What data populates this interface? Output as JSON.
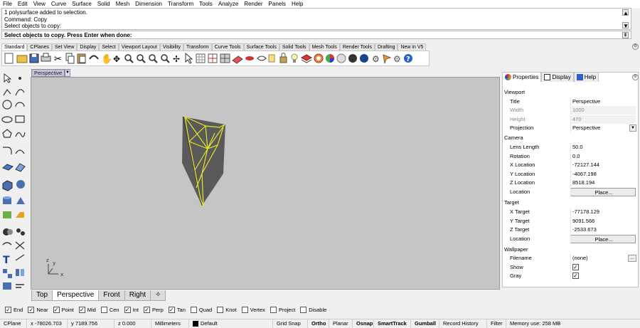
{
  "menu": [
    "File",
    "Edit",
    "View",
    "Curve",
    "Surface",
    "Solid",
    "Mesh",
    "Dimension",
    "Transform",
    "Tools",
    "Analyze",
    "Render",
    "Panels",
    "Help"
  ],
  "command_history": [
    "1 polysurface added to selection.",
    "Command: Copy",
    "Select objects to copy:"
  ],
  "command_prompt": "Select objects to copy. Press Enter when done:",
  "toolbar_tabs": [
    "Standard",
    "CPlanes",
    "Set View",
    "Display",
    "Select",
    "Viewport Layout",
    "Visibility",
    "Transform",
    "Curve Tools",
    "Surface Tools",
    "Solid Tools",
    "Mesh Tools",
    "Render Tools",
    "Drafting",
    "New in V5"
  ],
  "viewport": {
    "label": "Perspective"
  },
  "viewport_tabs": [
    "Top",
    "Perspective",
    "Front",
    "Right"
  ],
  "osnap": [
    {
      "label": "End",
      "checked": true
    },
    {
      "label": "Near",
      "checked": true
    },
    {
      "label": "Point",
      "checked": true
    },
    {
      "label": "Mid",
      "checked": true
    },
    {
      "label": "Cen",
      "checked": false
    },
    {
      "label": "Int",
      "checked": true
    },
    {
      "label": "Perp",
      "checked": true
    },
    {
      "label": "Tan",
      "checked": true
    },
    {
      "label": "Quad",
      "checked": false
    },
    {
      "label": "Knot",
      "checked": false
    },
    {
      "label": "Vertex",
      "checked": false
    },
    {
      "label": "Project",
      "checked": false
    },
    {
      "label": "Disable",
      "checked": false
    }
  ],
  "status": {
    "cplane": "CPlane",
    "x": "x -78026.703",
    "y": "y 7189.756",
    "z": "z 0.000",
    "units": "Millimeters",
    "layer": "Default",
    "grid_snap": "Grid Snap",
    "ortho": "Ortho",
    "planar": "Planar",
    "osnap": "Osnap",
    "smarttrack": "SmartTrack",
    "gumball": "Gumball",
    "record_history": "Record History",
    "filter": "Filter",
    "memory": "Memory use: 258 MB"
  },
  "panel": {
    "tabs": [
      "Properties",
      "Display",
      "Help"
    ],
    "viewport_section": "Viewport",
    "title_label": "Title",
    "title_value": "Perspective",
    "width_label": "Width",
    "width_value": "1000",
    "height_label": "Height",
    "height_value": "470",
    "projection_label": "Projection",
    "projection_value": "Perspective",
    "camera_section": "Camera",
    "lens_label": "Lens Length",
    "lens_value": "50.0",
    "rotation_label": "Rotation",
    "rotation_value": "0.0",
    "xloc_label": "X Location",
    "xloc_value": "-72127.144",
    "yloc_label": "Y Location",
    "yloc_value": "-4067.198",
    "zloc_label": "Z Location",
    "zloc_value": "8518.194",
    "location_label": "Location",
    "place_button": "Place...",
    "target_section": "Target",
    "xt_label": "X Target",
    "xt_value": "-77178.129",
    "yt_label": "Y Target",
    "yt_value": "9091.566",
    "zt_label": "Z Target",
    "zt_value": "-2533.673",
    "tloc_label": "Location",
    "tplace_button": "Place...",
    "wallpaper_section": "Wallpaper",
    "filename_label": "Filename",
    "filename_value": "(none)",
    "browse_button": "...",
    "show_label": "Show",
    "show_checked": true,
    "gray_label": "Gray",
    "gray_checked": true
  },
  "axis": {
    "x": "x",
    "y": "y",
    "z": "z"
  },
  "colors": {
    "viewport_bg": "#c5c5c5",
    "selection": "#e5e52a",
    "object": "#5a5a5a"
  }
}
